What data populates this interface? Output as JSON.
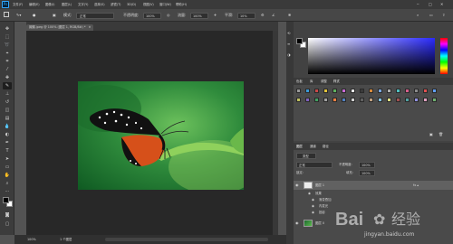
{
  "menubar": {
    "items": [
      "文件(F)",
      "编辑(E)",
      "图像(I)",
      "图层(L)",
      "文字(Y)",
      "选择(S)",
      "滤镜(T)",
      "3D(D)",
      "视图(V)",
      "窗口(W)",
      "帮助(H)"
    ]
  },
  "options": {
    "mode_label": "模式:",
    "mode_value": "正常",
    "opacity_label": "不透明度:",
    "opacity_value": "100%",
    "flow_label": "流量:",
    "flow_value": "100%",
    "smooth_label": "平滑:",
    "smooth_value": "10%"
  },
  "document_tab": {
    "title": "蝴蝶.jpeg @ 100% (图层 1, RGB/8#) *"
  },
  "status": {
    "zoom": "100%",
    "info": "1 个图层"
  },
  "color_panel": {
    "foreground": "#000000",
    "background": "#ffffff"
  },
  "swatches_panel": {
    "tabs": [
      "色板",
      "库",
      "调整",
      "样式"
    ],
    "active_tab": "样式"
  },
  "layers_panel": {
    "tabs": [
      "图层",
      "通道",
      "路径"
    ],
    "filter_label": "类型",
    "blend_mode": "正常",
    "opacity_label": "不透明度:",
    "opacity_value": "100%",
    "lock_label": "锁定:",
    "fill_label": "填充:",
    "fill_value": "100%",
    "layers": [
      {
        "name": "图层 1",
        "selected": true,
        "effects_label": "效果",
        "effects": [
          "渐变叠加",
          "内发光",
          "投影"
        ]
      },
      {
        "name": "图层 0",
        "selected": false
      }
    ]
  },
  "watermark": {
    "brand": "Bai",
    "brand_suffix": "经验",
    "url": "jingyan.baidu.com"
  }
}
